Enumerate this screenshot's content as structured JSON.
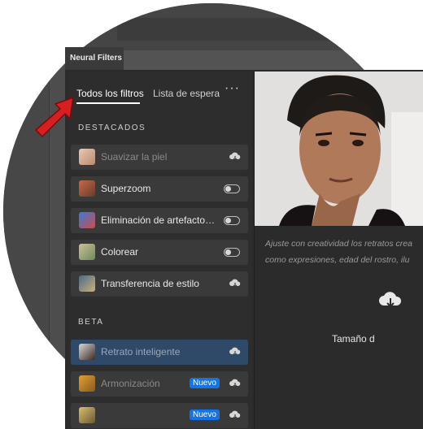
{
  "panel": {
    "title": "Neural Filters"
  },
  "tabs": [
    {
      "label": "Todos los filtros",
      "active": true
    },
    {
      "label": "Lista de espera",
      "active": false
    }
  ],
  "more_label": "···",
  "sections": {
    "featured": "DESTACADOS",
    "beta": "BETA"
  },
  "featured": [
    {
      "label": "Suavizar la piel",
      "control": "cloud",
      "enabled": false
    },
    {
      "label": "Superzoom",
      "control": "toggle",
      "enabled": true
    },
    {
      "label": "Eliminación de artefacto…",
      "control": "toggle",
      "enabled": true
    },
    {
      "label": "Colorear",
      "control": "toggle",
      "enabled": true
    },
    {
      "label": "Transferencia de estilo",
      "control": "cloud",
      "enabled": true
    }
  ],
  "beta": [
    {
      "label": "Retrato inteligente",
      "control": "cloud",
      "selected": true
    },
    {
      "label": "Armonización",
      "badge": "Nuevo",
      "control": "cloud"
    },
    {
      "badge": "Nuevo",
      "control": "cloud"
    }
  ],
  "detail": {
    "description_line1": "Ajuste con creatividad los retratos crea",
    "description_line2": "como expresiones, edad del rostro, ilu",
    "size_label": "Tamaño d"
  },
  "colors": {
    "accent": "#1473e6",
    "selected_row": "#2e4a68",
    "arrow": "#d62020"
  }
}
